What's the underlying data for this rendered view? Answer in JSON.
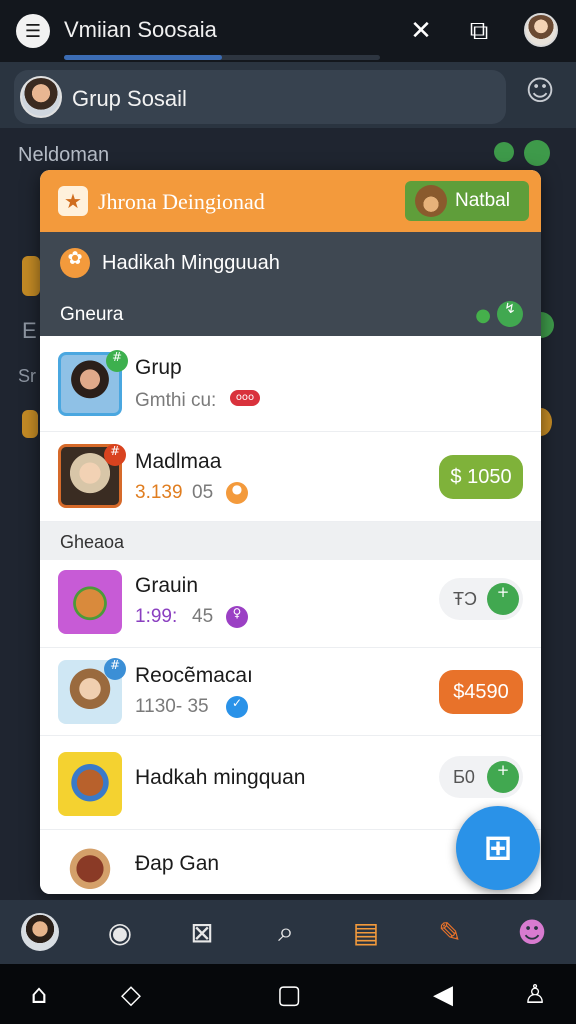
{
  "header": {
    "title": "Vmiian Soosaia",
    "progress_fraction": 0.5
  },
  "group": {
    "name": "Grup Sosail"
  },
  "background": {
    "section_label": "Neldoman",
    "frag_e": "E",
    "frag_sr": "Sr"
  },
  "card": {
    "header_title": "Jhrona Deingionad",
    "header_button": "Natbal",
    "sub_title": "Hadikah Mingguuah",
    "section1": "Gneura",
    "section2": "Gheaoa",
    "rows": [
      {
        "name": "Grup",
        "meta": "Gmthi cu:",
        "badge_text": "ooo",
        "tag_badge": "#"
      },
      {
        "name": "Madlmaa",
        "meta_orange": "3.139",
        "meta": "05",
        "price": "$ 1050",
        "tag_badge": "#"
      },
      {
        "name": "Grauin",
        "meta_purple": "1:99:",
        "meta": "45",
        "pill_num": "ŦƆ",
        "pill_action": "+"
      },
      {
        "name": "Reocẽmacaı",
        "meta": "1130-  35",
        "price": "$4590",
        "tag_badge": "#"
      },
      {
        "name": "Hadkah mingquan",
        "pill_num": "Ƃ0",
        "pill_action": "+"
      },
      {
        "name": "Đap Gan"
      }
    ]
  },
  "fab": {
    "icon": "grid-plus-icon"
  },
  "tabs": [
    "profile-icon",
    "chat-icon",
    "crossed-squares-icon",
    "search-icon",
    "folder-icon",
    "pencil-icon",
    "character-icon"
  ],
  "nav": [
    "home-icon",
    "back-icon",
    "square-icon",
    "play-icon",
    "person-icon"
  ]
}
